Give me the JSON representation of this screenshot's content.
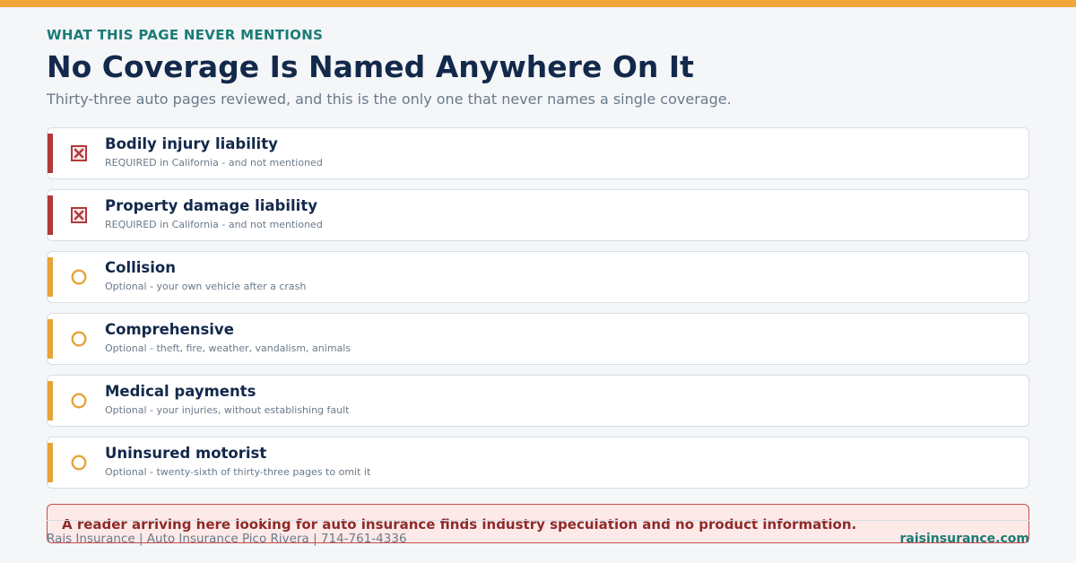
{
  "header": {
    "eyebrow": "WHAT THIS PAGE NEVER MENTIONS",
    "title": "No Coverage Is Named Anywhere On It",
    "subtitle": "Thirty-three auto pages reviewed, and this is the only one that never names a single coverage."
  },
  "colors": {
    "accent_bar": "#f0a63a",
    "required": "#b03a3a",
    "optional": "#e6a33a",
    "teal": "#1a7b76",
    "navy": "#13294b"
  },
  "coverages": [
    {
      "label": "Bodily injury liability",
      "note": "REQUIRED in California - and not mentioned",
      "status": "required",
      "icon": "x-box-icon"
    },
    {
      "label": "Property damage liability",
      "note": "REQUIRED in California - and not mentioned",
      "status": "required",
      "icon": "x-box-icon"
    },
    {
      "label": "Collision",
      "note": "Optional - your own vehicle after a crash",
      "status": "optional",
      "icon": "circle-icon"
    },
    {
      "label": "Comprehensive",
      "note": "Optional - theft, fire, weather, vandalism, animals",
      "status": "optional",
      "icon": "circle-icon"
    },
    {
      "label": "Medical payments",
      "note": "Optional - your injuries, without establishing fault",
      "status": "optional",
      "icon": "circle-icon"
    },
    {
      "label": "Uninsured motorist",
      "note": "Optional - twenty-sixth of thirty-three pages to omit it",
      "status": "optional",
      "icon": "circle-icon"
    }
  ],
  "callout": {
    "text": "A reader arriving here looking for auto insurance finds industry speculation and no product information."
  },
  "footer": {
    "left": "Rais Insurance  |  Auto Insurance Pico Rivera  |  714-761-4336",
    "right": "raisinsurance.com"
  }
}
